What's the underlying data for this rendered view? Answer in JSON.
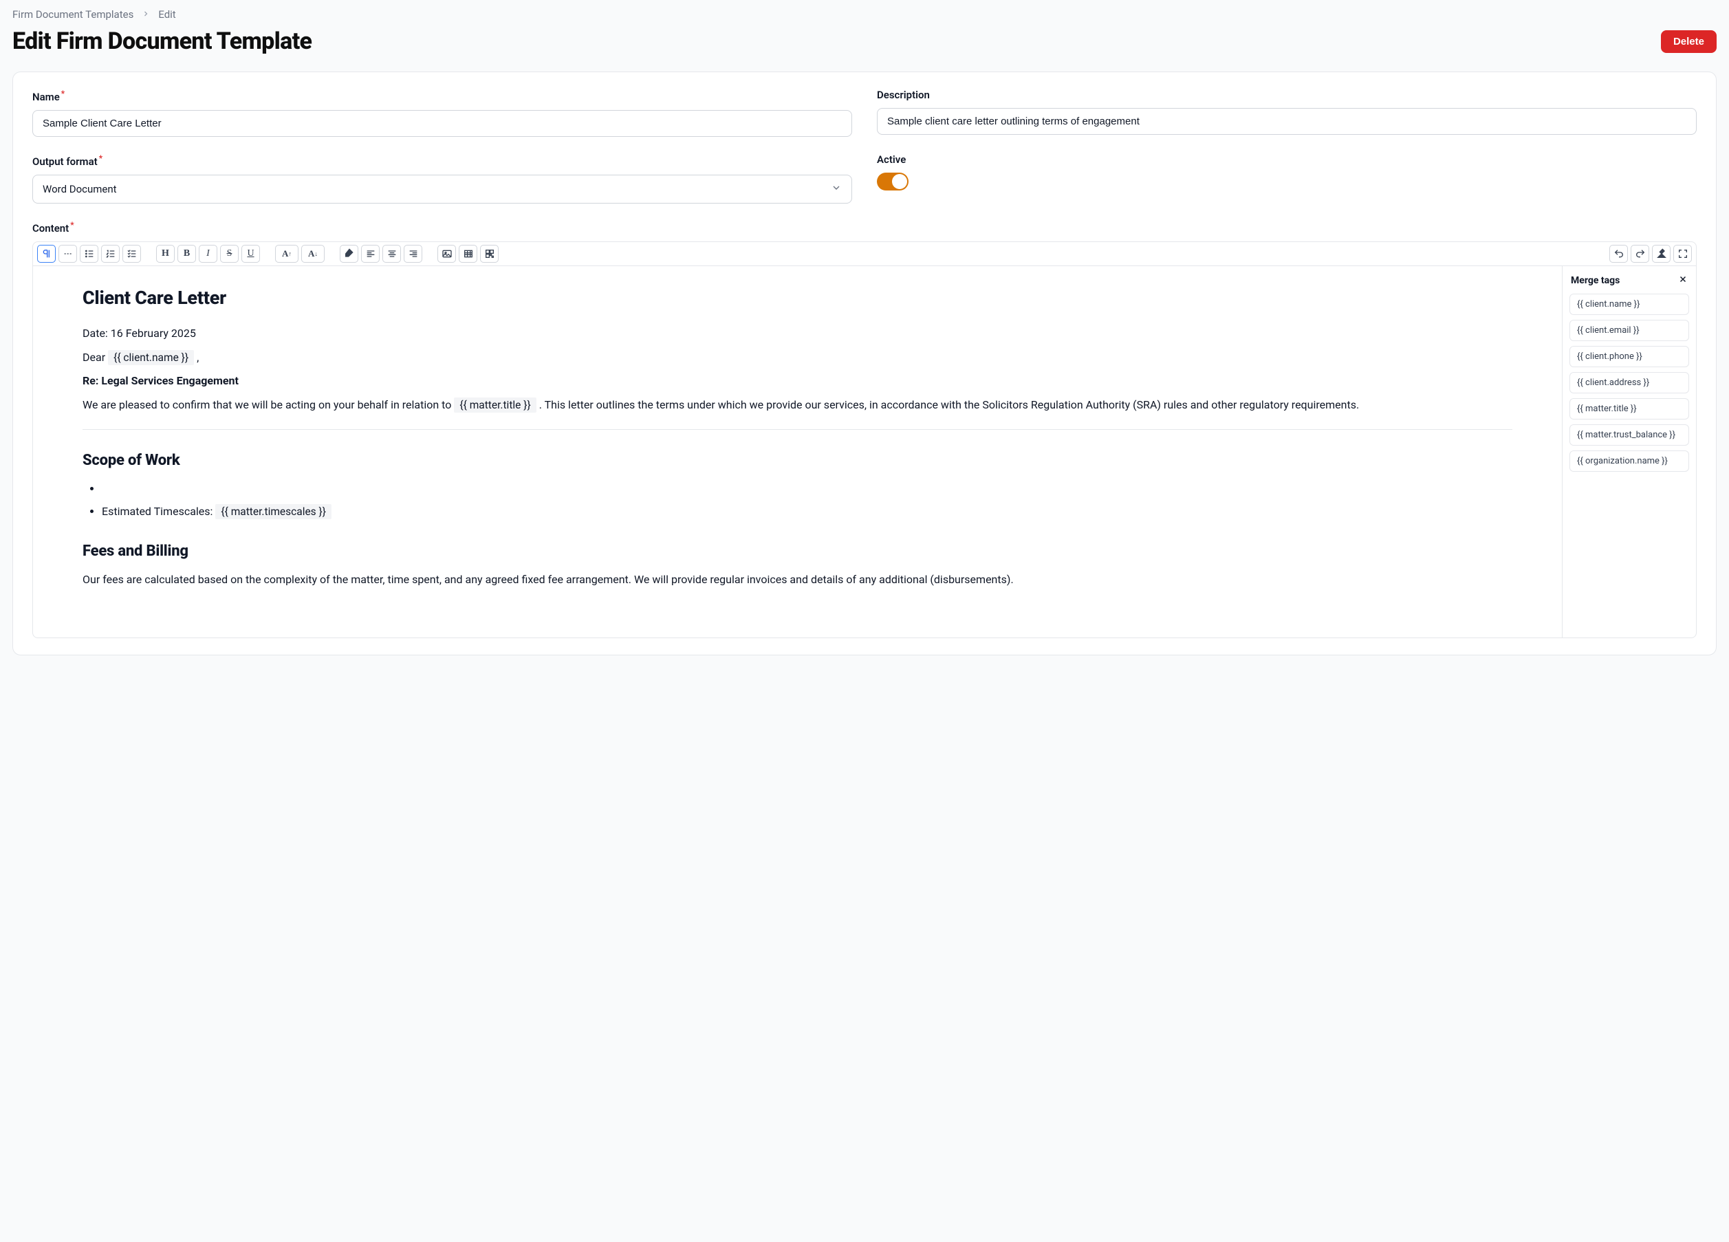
{
  "breadcrumb": {
    "parent": "Firm Document Templates",
    "current": "Edit"
  },
  "page_title": "Edit Firm Document Template",
  "buttons": {
    "delete": "Delete"
  },
  "form": {
    "name_label": "Name",
    "name_value": "Sample Client Care Letter",
    "description_label": "Description",
    "description_value": "Sample client care letter outlining terms of engagement",
    "output_format_label": "Output format",
    "output_format_value": "Word Document",
    "active_label": "Active",
    "active_value": true,
    "content_label": "Content"
  },
  "merge_panel": {
    "title": "Merge tags",
    "tags": [
      "{{ client.name }}",
      "{{ client.email }}",
      "{{ client.phone }}",
      "{{ client.address }}",
      "{{ matter.title }}",
      "{{ matter.trust_balance }}",
      "{{ organization.name }}"
    ]
  },
  "document": {
    "title": "Client Care Letter",
    "date_line": "Date: 16 February 2025",
    "dear_prefix": "Dear ",
    "client_name_tag": "{{ client.name }}",
    "dear_suffix": " ,",
    "re_line": "Re: Legal Services Engagement",
    "intro_prefix": "We are pleased to confirm that we will be acting on your behalf in relation to ",
    "matter_title_tag": "{{ matter.title }}",
    "intro_suffix": " . This letter outlines the terms under which we provide our services, in accordance with the Solicitors Regulation Authority (SRA) rules and other regulatory requirements.",
    "scope_heading": "Scope of Work",
    "timescales_label": "Estimated Timescales: ",
    "timescales_tag": "{{ matter.timescales }}",
    "fees_heading": "Fees and Billing",
    "fees_body": "Our fees are calculated based on the complexity of the matter, time spent, and any agreed fixed fee arrangement. We will provide regular invoices and details of any additional (disbursements)."
  }
}
